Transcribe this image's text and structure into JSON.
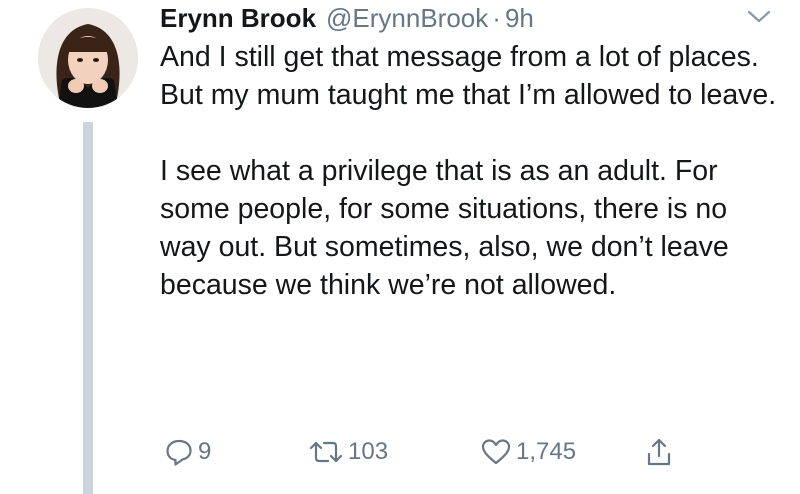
{
  "tweet": {
    "author": {
      "display_name": "Erynn Brook",
      "handle": "@ErynnBrook",
      "separator": "·",
      "time": "9h",
      "avatar_icon": "profile-photo"
    },
    "text": {
      "paragraph1": "And I still get that message from a lot of places. But my mum taught me that I’m allowed to leave.",
      "paragraph2": "I see what a privilege that is as an adult. For some people, for some situations, there is no way out. But sometimes, also, we don’t leave because we think we’re not allowed."
    },
    "actions": {
      "reply": {
        "icon": "reply-icon",
        "count": "9"
      },
      "retweet": {
        "icon": "retweet-icon",
        "count": "103"
      },
      "like": {
        "icon": "heart-icon",
        "count": "1,745"
      },
      "share": {
        "icon": "share-icon"
      }
    },
    "menu_icon": "chevron-down-icon"
  },
  "colors": {
    "text_primary": "#14171a",
    "text_secondary": "#657786",
    "thread_line": "#c9d4dc"
  }
}
